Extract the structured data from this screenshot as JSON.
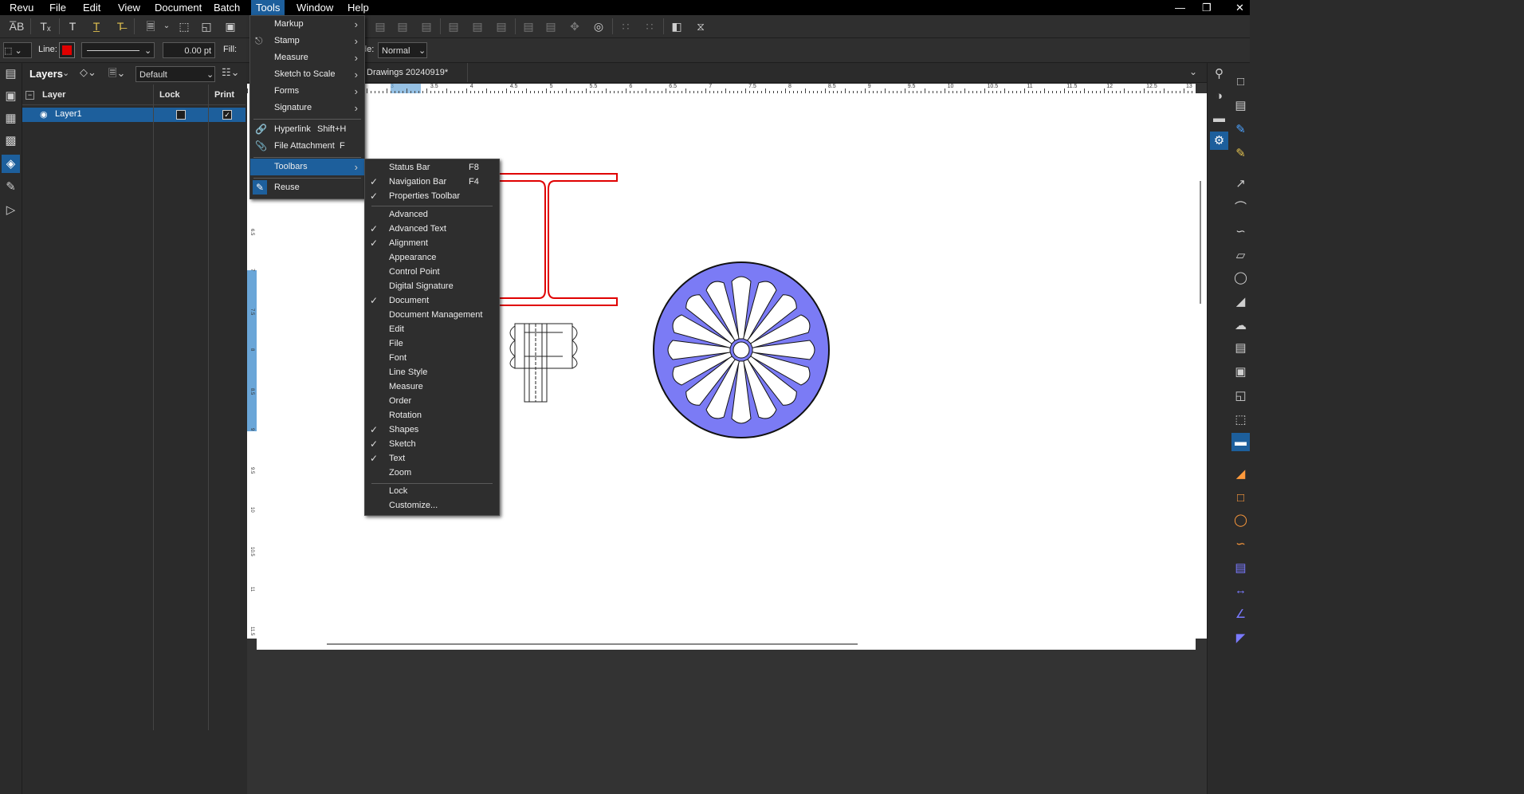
{
  "menubar": {
    "items": [
      "Revu",
      "File",
      "Edit",
      "View",
      "Document",
      "Batch",
      "Tools",
      "Window",
      "Help"
    ],
    "active": "Tools"
  },
  "toolbar2": {
    "line_label": "Line:",
    "line_width": "0.00 pt",
    "fill_label": "Fill:",
    "blend_label": "de:",
    "blend_value": "Normal"
  },
  "layers_panel": {
    "title": "Layers",
    "dropdown_value": "Default",
    "columns": [
      "Layer",
      "Lock",
      "Print"
    ],
    "rows": [
      {
        "name": "Layer1",
        "lock": false,
        "print": true
      }
    ]
  },
  "doc_tab": {
    "title": "Drawings 20240919*"
  },
  "ruler_top_ticks": [
    "3",
    "3.5",
    "4",
    "4.5",
    "5",
    "5.5",
    "6",
    "6.5",
    "7",
    "7.5",
    "8",
    "8.5",
    "9",
    "9.5",
    "10",
    "10.5",
    "11",
    "11.5",
    "12",
    "12.5",
    "13"
  ],
  "ruler_left_ticks": [
    "6.5",
    "7",
    "7.5",
    "8",
    "8.5",
    "9",
    "9.5",
    "10",
    "10.5",
    "11",
    "11.5"
  ],
  "tools_menu": {
    "items": [
      {
        "label": "Markup",
        "submenu": true,
        "icon": ""
      },
      {
        "label": "Stamp",
        "submenu": true,
        "icon": "stamp-icon"
      },
      {
        "label": "Measure",
        "submenu": true,
        "icon": ""
      },
      {
        "label": "Sketch to Scale",
        "submenu": true,
        "icon": ""
      },
      {
        "label": "Forms",
        "submenu": true,
        "icon": ""
      },
      {
        "label": "Signature",
        "submenu": true,
        "icon": ""
      },
      {
        "label": "Hyperlink",
        "shortcut": "Shift+H",
        "icon": "link-icon"
      },
      {
        "label": "File Attachment",
        "shortcut": "F",
        "icon": "paperclip-icon"
      },
      {
        "label": "Toolbars",
        "submenu": true,
        "highlighted": true
      },
      {
        "label": "Reuse",
        "icon": "brush-icon"
      }
    ]
  },
  "toolbars_submenu": {
    "items": [
      {
        "label": "Status Bar",
        "shortcut": "F8",
        "checked": false
      },
      {
        "label": "Navigation Bar",
        "shortcut": "F4",
        "checked": true
      },
      {
        "label": "Properties Toolbar",
        "checked": true
      },
      {
        "label": "Advanced",
        "checked": false
      },
      {
        "label": "Advanced Text",
        "checked": true
      },
      {
        "label": "Alignment",
        "checked": true
      },
      {
        "label": "Appearance",
        "checked": false
      },
      {
        "label": "Control Point",
        "checked": false
      },
      {
        "label": "Digital Signature",
        "checked": false
      },
      {
        "label": "Document",
        "checked": true
      },
      {
        "label": "Document Management",
        "checked": false
      },
      {
        "label": "Edit",
        "checked": false
      },
      {
        "label": "File",
        "checked": false
      },
      {
        "label": "Font",
        "checked": false
      },
      {
        "label": "Line Style",
        "checked": false
      },
      {
        "label": "Measure",
        "checked": false
      },
      {
        "label": "Order",
        "checked": false
      },
      {
        "label": "Rotation",
        "checked": false
      },
      {
        "label": "Shapes",
        "checked": true
      },
      {
        "label": "Sketch",
        "checked": true
      },
      {
        "label": "Text",
        "checked": true
      },
      {
        "label": "Zoom",
        "checked": false
      },
      {
        "label": "Lock",
        "checked": false
      },
      {
        "label": "Customize...",
        "checked": false
      }
    ]
  },
  "colors": {
    "accent": "#1d5f9c",
    "wheel_fill": "#7b7bf5",
    "beam_stroke": "#e00000",
    "line_color_swatch": "#e00000"
  }
}
